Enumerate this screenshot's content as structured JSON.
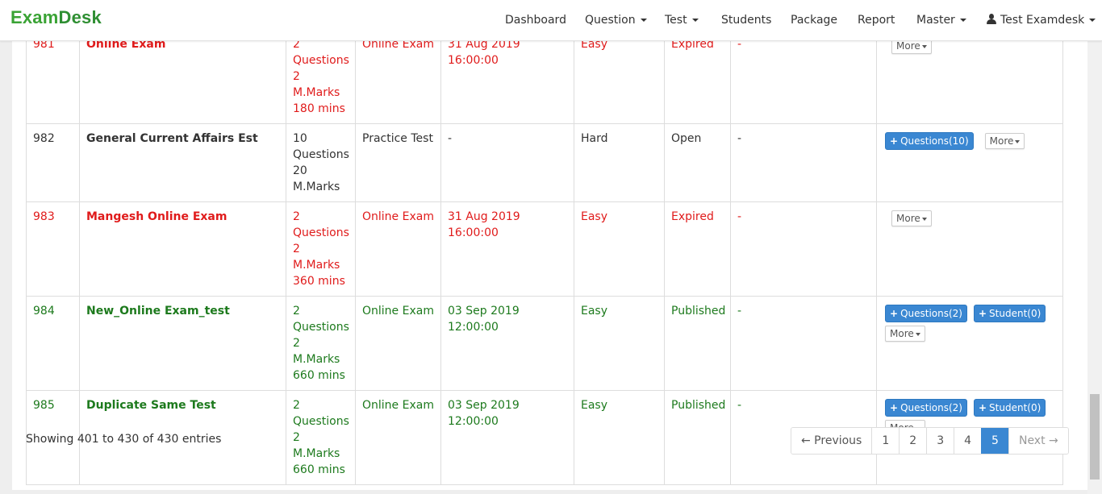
{
  "brand": {
    "part1": "Exam",
    "part2": "Desk"
  },
  "nav": {
    "dashboard": "Dashboard",
    "question": "Question",
    "test": "Test",
    "students": "Students",
    "package": "Package",
    "report": "Report",
    "master": "Master",
    "user": "Test Examdesk"
  },
  "colors": {
    "accent": "#3a87d2",
    "expired": "#e01b1b",
    "published": "#1d7a1d",
    "brand": "#3aa335"
  },
  "rows": [
    {
      "id": "981",
      "name": "Online Exam",
      "q1": "2",
      "q2": "Questions",
      "q3": "2 M.Marks",
      "q4": "180 mins",
      "type": "Online Exam",
      "date": "31 Aug 2019 16:00:00",
      "level": "Easy",
      "status": "Expired",
      "extra": "-",
      "more": "More"
    },
    {
      "id": "982",
      "name": "General Current Affairs Est",
      "q1": "10",
      "q2": "Questions",
      "q3": "20",
      "q4": "M.Marks",
      "type": "Practice Test",
      "date": "-",
      "level": "Hard",
      "status": "Open",
      "extra": "-",
      "questions_btn": "Questions(10)",
      "more": "More"
    },
    {
      "id": "983",
      "name": "Mangesh Online Exam",
      "q1": "2",
      "q2": "Questions",
      "q3": "2 M.Marks",
      "q4": "360 mins",
      "type": "Online Exam",
      "date": "31 Aug 2019 16:00:00",
      "level": "Easy",
      "status": "Expired",
      "extra": "-",
      "more": "More"
    },
    {
      "id": "984",
      "name": "New_Online Exam_test",
      "q1": "2",
      "q2": "Questions",
      "q3": "2 M.Marks",
      "q4": "660 mins",
      "type": "Online Exam",
      "date": "03 Sep 2019 12:00:00",
      "level": "Easy",
      "status": "Published",
      "extra": "-",
      "questions_btn": "Questions(2)",
      "student_btn": "Student(0)",
      "more": "More"
    },
    {
      "id": "985",
      "name": "Duplicate Same Test",
      "q1": "2",
      "q2": "Questions",
      "q3": "2 M.Marks",
      "q4": "660 mins",
      "type": "Online Exam",
      "date": "03 Sep 2019 12:00:00",
      "level": "Easy",
      "status": "Published",
      "extra": "-",
      "questions_btn": "Questions(2)",
      "student_btn": "Student(0)",
      "more": "More"
    }
  ],
  "footer": {
    "info": "Showing 401 to 430 of 430 entries"
  },
  "pagination": {
    "previous": "← Previous",
    "p1": "1",
    "p2": "2",
    "p3": "3",
    "p4": "4",
    "p5": "5",
    "next": "Next →"
  }
}
